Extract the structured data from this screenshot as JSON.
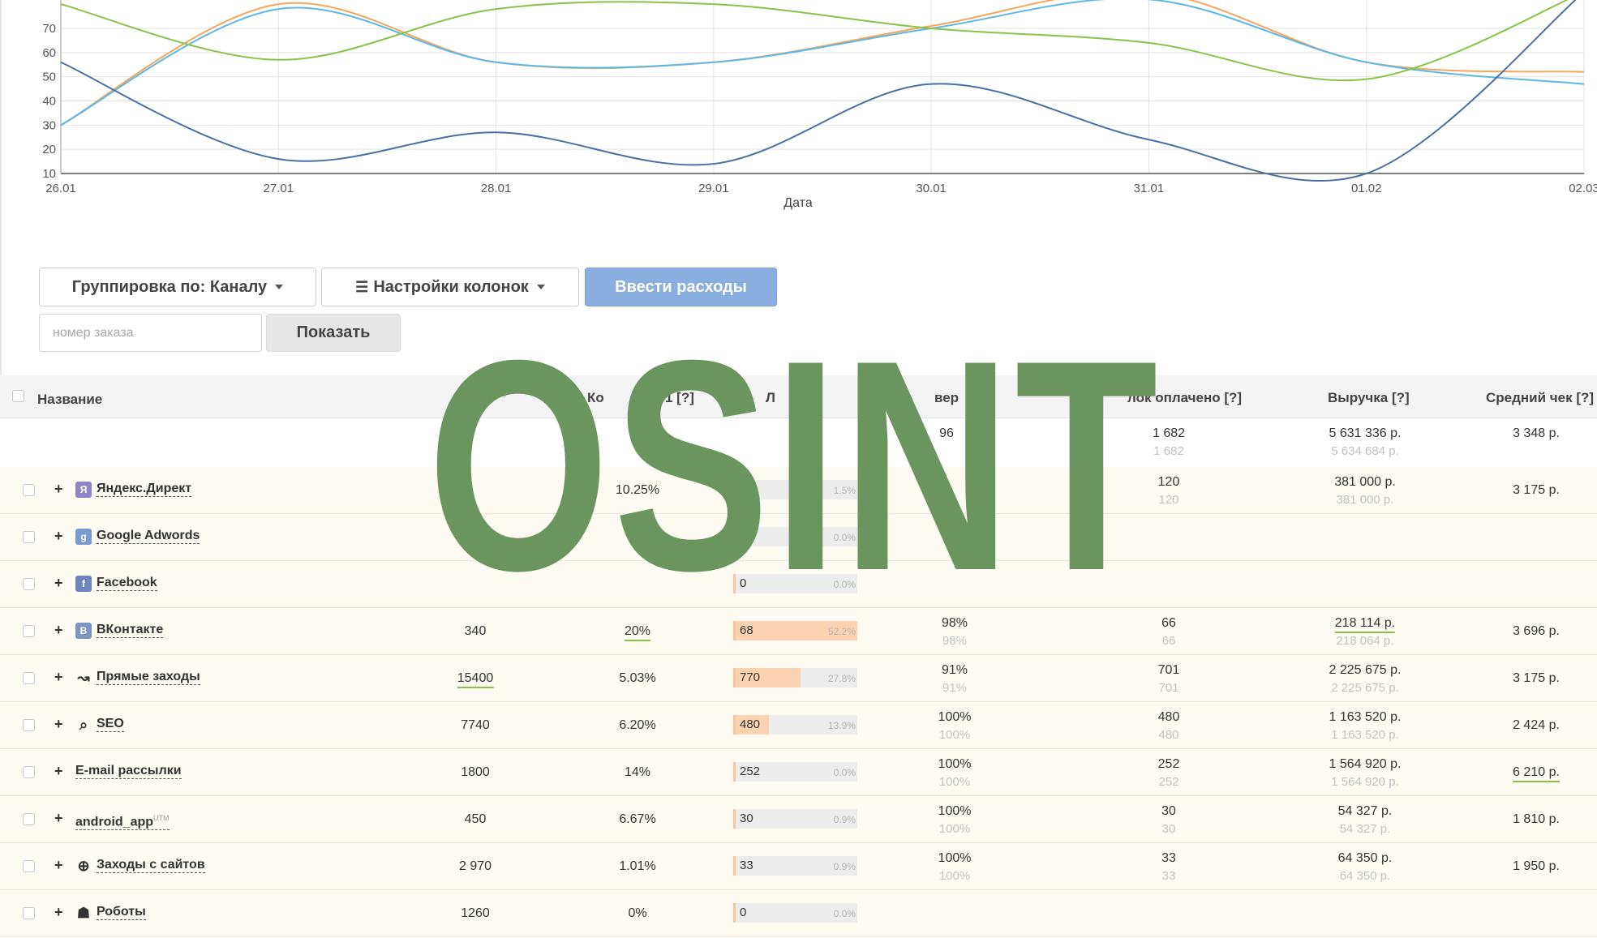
{
  "chart_data": {
    "type": "line",
    "xlabel": "Дата",
    "categories": [
      "26.01",
      "27.01",
      "28.01",
      "29.01",
      "30.01",
      "31.01",
      "01.02",
      "02.03"
    ],
    "yticks": [
      "10",
      "20",
      "30",
      "40",
      "50",
      "60",
      "70"
    ],
    "ylim": [
      10,
      70
    ],
    "grid": true,
    "series": [
      {
        "color": "#f5a65b",
        "values": [
          30,
          80,
          56,
          56,
          71,
          85,
          56,
          52
        ]
      },
      {
        "color": "#5bb8e8",
        "values": [
          30,
          78,
          56,
          56,
          70,
          82,
          56,
          47
        ]
      },
      {
        "color": "#8bc34a",
        "values": [
          80,
          57,
          78,
          80,
          70,
          64,
          49,
          85
        ]
      },
      {
        "color": "#4a6fa5",
        "values": [
          56,
          16,
          27,
          14,
          47,
          24,
          10,
          85
        ]
      }
    ]
  },
  "toolbar": {
    "group_label": "Группировка по: Каналу",
    "columns_label": "Настройки колонок",
    "expenses_label": "Ввести расходы",
    "order_placeholder": "номер заказа",
    "show_label": "Показать"
  },
  "table": {
    "headers": {
      "name": "Название",
      "col2": "[?]",
      "col3": "Ко",
      "col3b": "1 [?]",
      "col4": "Л",
      "col5": "вер",
      "paid": "лок оплачено [?]",
      "revenue": "Выручка [?]",
      "avg": "Средний чек [?]"
    },
    "totals": {
      "conv": "96",
      "paid": "1 682",
      "paid_sub": "1 682",
      "revenue": "5 631 336 р.",
      "revenue_sub": "5 634 684 р.",
      "avg": "3 348 р."
    },
    "rows": [
      {
        "icon": "yandex-direct-icon",
        "icon_glyph": "Я",
        "icon_color": "#8d86c7",
        "name": "Яндекс.Директ",
        "sup": "",
        "visits": "",
        "conv_rate": "10.25%",
        "leads": "20",
        "lead_pct": "1.5%",
        "lead_fill": 0.0,
        "pay_rate": "",
        "pay_rate_sub": "",
        "paid": "120",
        "paid_sub": "120",
        "revenue": "381 000 р.",
        "revenue_sub": "381 000 р.",
        "avg": "3 175 р."
      },
      {
        "icon": "google-adwords-icon",
        "icon_glyph": "g",
        "icon_color": "#7a9bd0",
        "name": "Google Adwords",
        "sup": "",
        "visits": "",
        "conv_rate": "",
        "leads": "",
        "lead_pct": "0.0%",
        "lead_fill": 0.0,
        "pay_rate": "",
        "pay_rate_sub": "",
        "paid": "",
        "paid_sub": "",
        "revenue": "",
        "revenue_sub": "",
        "avg": ""
      },
      {
        "icon": "facebook-icon",
        "icon_glyph": "f",
        "icon_color": "#6d86bf",
        "name": "Facebook",
        "sup": "",
        "visits": "",
        "conv_rate": "",
        "leads": "0",
        "lead_pct": "0.0%",
        "lead_fill": 0.0,
        "pay_rate": "",
        "pay_rate_sub": "",
        "paid": "",
        "paid_sub": "",
        "revenue": "",
        "revenue_sub": "",
        "avg": ""
      },
      {
        "icon": "vkontakte-icon",
        "icon_glyph": "B",
        "icon_color": "#7a95c4",
        "name": "ВКонтакте",
        "sup": "",
        "visits": "340",
        "conv_rate": "20%",
        "leads": "68",
        "lead_pct": "52.2%",
        "lead_fill": 1.0,
        "pay_rate": "98%",
        "pay_rate_sub": "98%",
        "paid": "66",
        "paid_sub": "66",
        "revenue": "218 114 р.",
        "revenue_sub": "218 064 р.",
        "avg": "3 696 р."
      },
      {
        "icon": "direct-visits-icon",
        "icon_glyph": "↝",
        "icon_color": "transparent",
        "name": "Прямые заходы",
        "sup": "",
        "visits": "15400",
        "conv_rate": "5.03%",
        "leads": "770",
        "lead_pct": "27.8%",
        "lead_fill": 0.53,
        "pay_rate": "91%",
        "pay_rate_sub": "91%",
        "paid": "701",
        "paid_sub": "701",
        "revenue": "2 225 675 р.",
        "revenue_sub": "2 225 675 р.",
        "avg": "3 175 р."
      },
      {
        "icon": "search-icon",
        "icon_glyph": "⌕",
        "icon_color": "transparent",
        "name": "SEO",
        "sup": "",
        "visits": "7740",
        "conv_rate": "6.20%",
        "leads": "480",
        "lead_pct": "13.9%",
        "lead_fill": 0.27,
        "pay_rate": "100%",
        "pay_rate_sub": "100%",
        "paid": "480",
        "paid_sub": "480",
        "revenue": "1 163 520 р.",
        "revenue_sub": "1 163 520 р.",
        "avg": "2 424 р."
      },
      {
        "icon": "",
        "icon_glyph": "",
        "icon_color": "transparent",
        "name": "E-mail рассылки",
        "sup": "",
        "visits": "1800",
        "conv_rate": "14%",
        "leads": "252",
        "lead_pct": "0.0%",
        "lead_fill": 0.0,
        "pay_rate": "100%",
        "pay_rate_sub": "100%",
        "paid": "252",
        "paid_sub": "252",
        "revenue": "1 564 920 р.",
        "revenue_sub": "1 564 920 р.",
        "avg": "6 210 р."
      },
      {
        "icon": "",
        "icon_glyph": "",
        "icon_color": "transparent",
        "name": "android_app",
        "sup": "UTM",
        "visits": "450",
        "conv_rate": "6.67%",
        "leads": "30",
        "lead_pct": "0.9%",
        "lead_fill": 0.0,
        "pay_rate": "100%",
        "pay_rate_sub": "100%",
        "paid": "30",
        "paid_sub": "30",
        "revenue": "54 327 р.",
        "revenue_sub": "54 327 р.",
        "avg": "1 810 р."
      },
      {
        "icon": "globe-icon",
        "icon_glyph": "⊕",
        "icon_color": "transparent",
        "name": "Заходы с сайтов",
        "sup": "",
        "visits": "2 970",
        "conv_rate": "1.01%",
        "leads": "33",
        "lead_pct": "0.9%",
        "lead_fill": 0.0,
        "pay_rate": "100%",
        "pay_rate_sub": "100%",
        "paid": "33",
        "paid_sub": "33",
        "revenue": "64 350 р.",
        "revenue_sub": "64 350 р.",
        "avg": "1 950 р."
      },
      {
        "icon": "robot-icon",
        "icon_glyph": "☗",
        "icon_color": "transparent",
        "name": "Роботы",
        "sup": "",
        "visits": "1260",
        "conv_rate": "0%",
        "leads": "0",
        "lead_pct": "0.0%",
        "lead_fill": 0.0,
        "pay_rate": "",
        "pay_rate_sub": "",
        "paid": "",
        "paid_sub": "",
        "revenue": "",
        "revenue_sub": "",
        "avg": ""
      }
    ]
  },
  "watermark": "OSINT"
}
